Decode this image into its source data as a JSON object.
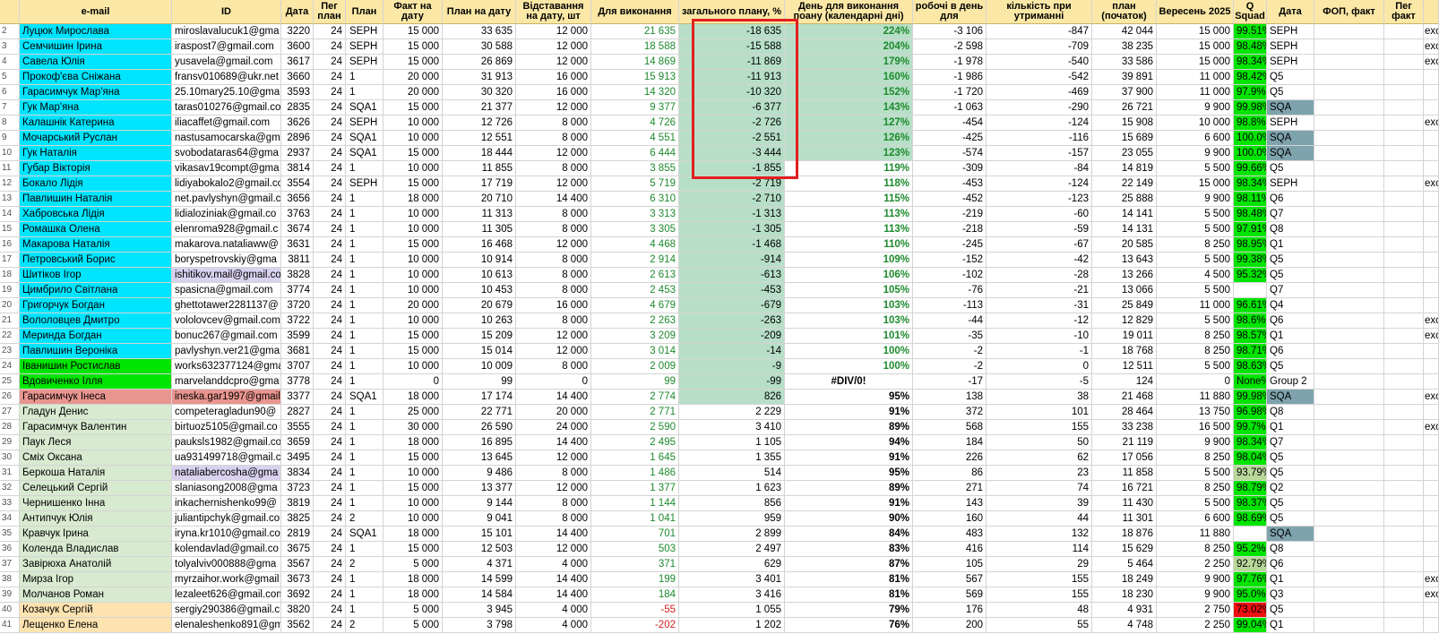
{
  "headers": [
    "",
    "e-mail",
    "ID",
    "Дата",
    "Пег план",
    "План",
    "Факт на дату",
    "План на дату",
    "Відставання на дату, шт",
    "Для виконання",
    "загального плану, %",
    "День для виконання поану (календарні дні)",
    "робочі в день для",
    "кількість при утриманні",
    "план (початок)",
    "Вересень 2025",
    "Q Squad",
    "Дата",
    "ФОП, факт",
    "Пег факт",
    ""
  ],
  "rows": [
    {
      "rn": "2",
      "name": "Луцюк Мирослава",
      "email": "miroslavalucuk1@gma",
      "id": "3220",
      "d": "24",
      "peg": "SEPH",
      "plan": "15 000",
      "fact": "33 635",
      "pd": "12 000",
      "lag": "21 635",
      "need": "-18 635",
      "pct": "224%",
      "days": "-3 106",
      "wd": "-847",
      "ret": "42 044",
      "ps": "15 000",
      "sep": "99.51%",
      "sq": "SEPH",
      "extra": "exc"
    },
    {
      "rn": "3",
      "name": "Семчишин Ірина",
      "email": "iraspost7@gmail.com",
      "id": "3600",
      "d": "24",
      "peg": "SEPH",
      "plan": "15 000",
      "fact": "30 588",
      "pd": "12 000",
      "lag": "18 588",
      "need": "-15 588",
      "pct": "204%",
      "days": "-2 598",
      "wd": "-709",
      "ret": "38 235",
      "ps": "15 000",
      "sep": "98.48%",
      "sq": "SEPH",
      "extra": "exc"
    },
    {
      "rn": "4",
      "name": "Савела Юлія",
      "email": "yusavela@gmail.com",
      "id": "3617",
      "d": "24",
      "peg": "SEPH",
      "plan": "15 000",
      "fact": "26 869",
      "pd": "12 000",
      "lag": "14 869",
      "need": "-11 869",
      "pct": "179%",
      "days": "-1 978",
      "wd": "-540",
      "ret": "33 586",
      "ps": "15 000",
      "sep": "98.34%",
      "sq": "SEPH",
      "extra": "exc"
    },
    {
      "rn": "5",
      "name": "Прокоф'єва Сніжана",
      "email": "fransv010689@ukr.net",
      "id": "3660",
      "d": "24",
      "peg": "1",
      "plan": "20 000",
      "fact": "31 913",
      "pd": "16 000",
      "lag": "15 913",
      "need": "-11 913",
      "pct": "160%",
      "days": "-1 986",
      "wd": "-542",
      "ret": "39 891",
      "ps": "11 000",
      "sep": "98.42%",
      "sq": "Q5",
      "extra": ""
    },
    {
      "rn": "6",
      "name": "Гарасимчук Мар'яна",
      "email": "25.10mary25.10@gma",
      "id": "3593",
      "d": "24",
      "peg": "1",
      "plan": "20 000",
      "fact": "30 320",
      "pd": "16 000",
      "lag": "14 320",
      "need": "-10 320",
      "pct": "152%",
      "days": "-1 720",
      "wd": "-469",
      "ret": "37 900",
      "ps": "11 000",
      "sep": "97.9%",
      "sq": "Q5",
      "extra": ""
    },
    {
      "rn": "7",
      "name": "Гук Мар'яна",
      "email": "taras010276@gmail.co",
      "id": "2835",
      "d": "24",
      "peg": "SQA1",
      "plan": "15 000",
      "fact": "21 377",
      "pd": "12 000",
      "lag": "9 377",
      "need": "-6 377",
      "pct": "143%",
      "days": "-1 063",
      "wd": "-290",
      "ret": "26 721",
      "ps": "9 900",
      "sep": "99.98%",
      "sq": "SQA",
      "extra": ""
    },
    {
      "rn": "8",
      "name": "Калашнік Катерина",
      "email": "iliacaffet@gmail.com",
      "id": "3626",
      "d": "24",
      "peg": "SEPH",
      "plan": "10 000",
      "fact": "12 726",
      "pd": "8 000",
      "lag": "4 726",
      "need": "-2 726",
      "pct": "127%",
      "days": "-454",
      "wd": "-124",
      "ret": "15 908",
      "ps": "10 000",
      "sep": "98.8%",
      "sq": "SEPH",
      "extra": "exc"
    },
    {
      "rn": "9",
      "name": "Мочарський Руслан",
      "email": "nastusamocarska@gma",
      "id": "2896",
      "d": "24",
      "peg": "SQA1",
      "plan": "10 000",
      "fact": "12 551",
      "pd": "8 000",
      "lag": "4 551",
      "need": "-2 551",
      "pct": "126%",
      "days": "-425",
      "wd": "-116",
      "ret": "15 689",
      "ps": "6 600",
      "sep": "100.0%",
      "sq": "SQA",
      "extra": ""
    },
    {
      "rn": "10",
      "name": "Гук Наталія",
      "email": "svobodataras64@gma",
      "id": "2937",
      "d": "24",
      "peg": "SQA1",
      "plan": "15 000",
      "fact": "18 444",
      "pd": "12 000",
      "lag": "6 444",
      "need": "-3 444",
      "pct": "123%",
      "days": "-574",
      "wd": "-157",
      "ret": "23 055",
      "ps": "9 900",
      "sep": "100.0%",
      "sq": "SQA",
      "extra": ""
    },
    {
      "rn": "11",
      "name": "Губар Вікторія",
      "email": "vikasav19compt@gma",
      "id": "3814",
      "d": "24",
      "peg": "1",
      "plan": "10 000",
      "fact": "11 855",
      "pd": "8 000",
      "lag": "3 855",
      "need": "-1 855",
      "pct": "119%",
      "days": "-309",
      "wd": "-84",
      "ret": "14 819",
      "ps": "5 500",
      "sep": "99.66%",
      "sq": "Q5",
      "extra": ""
    },
    {
      "rn": "12",
      "name": "Бокало Лідія",
      "email": "lidiyabokalo2@gmail.co",
      "id": "3554",
      "d": "24",
      "peg": "SEPH",
      "plan": "15 000",
      "fact": "17 719",
      "pd": "12 000",
      "lag": "5 719",
      "need": "-2 719",
      "pct": "118%",
      "days": "-453",
      "wd": "-124",
      "ret": "22 149",
      "ps": "15 000",
      "sep": "98.34%",
      "sq": "SEPH",
      "extra": "exc"
    },
    {
      "rn": "13",
      "name": "Павлишин Наталія",
      "email": "net.pavlyshyn@gmail.c",
      "id": "3656",
      "d": "24",
      "peg": "1",
      "plan": "18 000",
      "fact": "20 710",
      "pd": "14 400",
      "lag": "6 310",
      "need": "-2 710",
      "pct": "115%",
      "days": "-452",
      "wd": "-123",
      "ret": "25 888",
      "ps": "9 900",
      "sep": "98.11%",
      "sq": "Q6",
      "extra": ""
    },
    {
      "rn": "14",
      "name": "Хабровська Лідія",
      "email": "lidialoziniak@gmail.co",
      "id": "3763",
      "d": "24",
      "peg": "1",
      "plan": "10 000",
      "fact": "11 313",
      "pd": "8 000",
      "lag": "3 313",
      "need": "-1 313",
      "pct": "113%",
      "days": "-219",
      "wd": "-60",
      "ret": "14 141",
      "ps": "5 500",
      "sep": "98.48%",
      "sq": "Q7",
      "extra": ""
    },
    {
      "rn": "15",
      "name": "Ромашка Олена",
      "email": "elenroma928@gmail.c",
      "id": "3674",
      "d": "24",
      "peg": "1",
      "plan": "10 000",
      "fact": "11 305",
      "pd": "8 000",
      "lag": "3 305",
      "need": "-1 305",
      "pct": "113%",
      "days": "-218",
      "wd": "-59",
      "ret": "14 131",
      "ps": "5 500",
      "sep": "97.91%",
      "sq": "Q8",
      "extra": ""
    },
    {
      "rn": "16",
      "name": "Макарова Наталія",
      "email": "makarova.nataliaww@",
      "id": "3631",
      "d": "24",
      "peg": "1",
      "plan": "15 000",
      "fact": "16 468",
      "pd": "12 000",
      "lag": "4 468",
      "need": "-1 468",
      "pct": "110%",
      "days": "-245",
      "wd": "-67",
      "ret": "20 585",
      "ps": "8 250",
      "sep": "98.95%",
      "sq": "Q1",
      "extra": ""
    },
    {
      "rn": "17",
      "name": "Петровський Борис",
      "email": "boryspetrovskiy@gma",
      "id": "3811",
      "d": "24",
      "peg": "1",
      "plan": "10 000",
      "fact": "10 914",
      "pd": "8 000",
      "lag": "2 914",
      "need": "-914",
      "pct": "109%",
      "days": "-152",
      "wd": "-42",
      "ret": "13 643",
      "ps": "5 500",
      "sep": "99.38%",
      "sq": "Q5",
      "extra": ""
    },
    {
      "rn": "18",
      "name": "Шитіков Ігор",
      "email": "ishitikov.mail@gmail.co",
      "id": "3828",
      "d": "24",
      "peg": "1",
      "plan": "10 000",
      "fact": "10 613",
      "pd": "8 000",
      "lag": "2 613",
      "need": "-613",
      "pct": "106%",
      "days": "-102",
      "wd": "-28",
      "ret": "13 266",
      "ps": "4 500",
      "sep": "95.32%",
      "sq": "Q5",
      "extra": ""
    },
    {
      "rn": "19",
      "name": "Цимбрило Світлана",
      "email": "spasicna@gmail.com",
      "id": "3774",
      "d": "24",
      "peg": "1",
      "plan": "10 000",
      "fact": "10 453",
      "pd": "8 000",
      "lag": "2 453",
      "need": "-453",
      "pct": "105%",
      "days": "-76",
      "wd": "-21",
      "ret": "13 066",
      "ps": "5 500",
      "sep": "",
      "sq": "Q7",
      "extra": ""
    },
    {
      "rn": "20",
      "name": "Григорчук Богдан",
      "email": "ghettotawer2281137@",
      "id": "3720",
      "d": "24",
      "peg": "1",
      "plan": "20 000",
      "fact": "20 679",
      "pd": "16 000",
      "lag": "4 679",
      "need": "-679",
      "pct": "103%",
      "days": "-113",
      "wd": "-31",
      "ret": "25 849",
      "ps": "11 000",
      "sep": "96.61%",
      "sq": "Q4",
      "extra": ""
    },
    {
      "rn": "21",
      "name": "Вололовцев Дмитро",
      "email": "vololovcev@gmail.com",
      "id": "3722",
      "d": "24",
      "peg": "1",
      "plan": "10 000",
      "fact": "10 263",
      "pd": "8 000",
      "lag": "2 263",
      "need": "-263",
      "pct": "103%",
      "days": "-44",
      "wd": "-12",
      "ret": "12 829",
      "ps": "5 500",
      "sep": "98.6%",
      "sq": "Q6",
      "extra": "exc"
    },
    {
      "rn": "22",
      "name": "Меринда Богдан",
      "email": "bonuc267@gmail.com",
      "id": "3599",
      "d": "24",
      "peg": "1",
      "plan": "15 000",
      "fact": "15 209",
      "pd": "12 000",
      "lag": "3 209",
      "need": "-209",
      "pct": "101%",
      "days": "-35",
      "wd": "-10",
      "ret": "19 011",
      "ps": "8 250",
      "sep": "98.57%",
      "sq": "Q1",
      "extra": "exc"
    },
    {
      "rn": "23",
      "name": "Павлишин Вероніка",
      "email": "pavlyshyn.ver21@gma",
      "id": "3681",
      "d": "24",
      "peg": "1",
      "plan": "15 000",
      "fact": "15 014",
      "pd": "12 000",
      "lag": "3 014",
      "need": "-14",
      "pct": "100%",
      "days": "-2",
      "wd": "-1",
      "ret": "18 768",
      "ps": "8 250",
      "sep": "98.71%",
      "sq": "Q6",
      "extra": ""
    },
    {
      "rn": "24",
      "name": "Іванишин Ростислав",
      "email": "works632377124@gma",
      "id": "3707",
      "d": "24",
      "peg": "1",
      "plan": "10 000",
      "fact": "10 009",
      "pd": "8 000",
      "lag": "2 009",
      "need": "-9",
      "pct": "100%",
      "days": "-2",
      "wd": "0",
      "ret": "12 511",
      "ps": "5 500",
      "sep": "98.63%",
      "sq": "Q5",
      "extra": ""
    },
    {
      "rn": "25",
      "name": "Вдовиченко Ілля",
      "email": "marvelanddcpro@gma",
      "id": "3778",
      "d": "24",
      "peg": "1",
      "plan": "0",
      "fact": "99",
      "pd": "0",
      "lag": "99",
      "need": "-99",
      "pct": "#DIV/0!",
      "days": "-17",
      "wd": "-5",
      "ret": "124",
      "ps": "0",
      "sep": "None%",
      "sq": "Group 2",
      "extra": ""
    },
    {
      "rn": "26",
      "name": "Гарасимчук Інеса",
      "email": "ineska.gar1997@gmail",
      "id": "3377",
      "d": "24",
      "peg": "SQA1",
      "plan": "18 000",
      "fact": "17 174",
      "pd": "14 400",
      "lag": "2 774",
      "need": "826",
      "pct": "95%",
      "days": "138",
      "wd": "38",
      "ret": "21 468",
      "ps": "11 880",
      "sep": "99.98%",
      "sq": "SQA",
      "extra": "exc"
    },
    {
      "rn": "27",
      "name": "Гладун Денис",
      "email": "competeragladun90@",
      "id": "2827",
      "d": "24",
      "peg": "1",
      "plan": "25 000",
      "fact": "22 771",
      "pd": "20 000",
      "lag": "2 771",
      "need": "2 229",
      "pct": "91%",
      "days": "372",
      "wd": "101",
      "ret": "28 464",
      "ps": "13 750",
      "sep": "96.98%",
      "sq": "Q8",
      "extra": ""
    },
    {
      "rn": "28",
      "name": "Гарасимчук Валентин",
      "email": "birtuoz5105@gmail.co",
      "id": "3555",
      "d": "24",
      "peg": "1",
      "plan": "30 000",
      "fact": "26 590",
      "pd": "24 000",
      "lag": "2 590",
      "need": "3 410",
      "pct": "89%",
      "days": "568",
      "wd": "155",
      "ret": "33 238",
      "ps": "16 500",
      "sep": "99.7%",
      "sq": "Q1",
      "extra": "exc"
    },
    {
      "rn": "29",
      "name": "Паук Леся",
      "email": "pauksls1982@gmail.co",
      "id": "3659",
      "d": "24",
      "peg": "1",
      "plan": "18 000",
      "fact": "16 895",
      "pd": "14 400",
      "lag": "2 495",
      "need": "1 105",
      "pct": "94%",
      "days": "184",
      "wd": "50",
      "ret": "21 119",
      "ps": "9 900",
      "sep": "98.34%",
      "sq": "Q7",
      "extra": ""
    },
    {
      "rn": "30",
      "name": "Сміх Оксана",
      "email": "ua931499718@gmail.c",
      "id": "3495",
      "d": "24",
      "peg": "1",
      "plan": "15 000",
      "fact": "13 645",
      "pd": "12 000",
      "lag": "1 645",
      "need": "1 355",
      "pct": "91%",
      "days": "226",
      "wd": "62",
      "ret": "17 056",
      "ps": "8 250",
      "sep": "98.04%",
      "sq": "Q5",
      "extra": ""
    },
    {
      "rn": "31",
      "name": "Беркоша Наталія",
      "email": "nataliabercosha@gma",
      "id": "3834",
      "d": "24",
      "peg": "1",
      "plan": "10 000",
      "fact": "9 486",
      "pd": "8 000",
      "lag": "1 486",
      "need": "514",
      "pct": "95%",
      "days": "86",
      "wd": "23",
      "ret": "11 858",
      "ps": "5 500",
      "sep": "93.79%",
      "sq": "Q5",
      "extra": ""
    },
    {
      "rn": "32",
      "name": "Селецький Сергій",
      "email": "slaniasong2008@gma",
      "id": "3723",
      "d": "24",
      "peg": "1",
      "plan": "15 000",
      "fact": "13 377",
      "pd": "12 000",
      "lag": "1 377",
      "need": "1 623",
      "pct": "89%",
      "days": "271",
      "wd": "74",
      "ret": "16 721",
      "ps": "8 250",
      "sep": "98.79%",
      "sq": "Q2",
      "extra": ""
    },
    {
      "rn": "33",
      "name": "Чернишенко Інна",
      "email": "inkachernishenko99@",
      "id": "3819",
      "d": "24",
      "peg": "1",
      "plan": "10 000",
      "fact": "9 144",
      "pd": "8 000",
      "lag": "1 144",
      "need": "856",
      "pct": "91%",
      "days": "143",
      "wd": "39",
      "ret": "11 430",
      "ps": "5 500",
      "sep": "98.37%",
      "sq": "Q5",
      "extra": ""
    },
    {
      "rn": "34",
      "name": "Антипчук Юлія",
      "email": "juliantipchyk@gmail.co",
      "id": "3825",
      "d": "24",
      "peg": "2",
      "plan": "10 000",
      "fact": "9 041",
      "pd": "8 000",
      "lag": "1 041",
      "need": "959",
      "pct": "90%",
      "days": "160",
      "wd": "44",
      "ret": "11 301",
      "ps": "6 600",
      "sep": "98.69%",
      "sq": "Q5",
      "extra": ""
    },
    {
      "rn": "35",
      "name": "Кравчук Ірина",
      "email": "iryna.kr1010@gmail.co",
      "id": "2819",
      "d": "24",
      "peg": "SQA1",
      "plan": "18 000",
      "fact": "15 101",
      "pd": "14 400",
      "lag": "701",
      "need": "2 899",
      "pct": "84%",
      "days": "483",
      "wd": "132",
      "ret": "18 876",
      "ps": "11 880",
      "sep": "",
      "sq": "SQA",
      "extra": ""
    },
    {
      "rn": "36",
      "name": "Колендa Владислав",
      "email": "kolendavlad@gmail.co",
      "id": "3675",
      "d": "24",
      "peg": "1",
      "plan": "15 000",
      "fact": "12 503",
      "pd": "12 000",
      "lag": "503",
      "need": "2 497",
      "pct": "83%",
      "days": "416",
      "wd": "114",
      "ret": "15 629",
      "ps": "8 250",
      "sep": "95.2%",
      "sq": "Q8",
      "extra": ""
    },
    {
      "rn": "37",
      "name": "Завірюха Анатолій",
      "email": "tolyalviv000888@gma",
      "id": "3567",
      "d": "24",
      "peg": "2",
      "plan": "5 000",
      "fact": "4 371",
      "pd": "4 000",
      "lag": "371",
      "need": "629",
      "pct": "87%",
      "days": "105",
      "wd": "29",
      "ret": "5 464",
      "ps": "2 250",
      "sep": "92.79%",
      "sq": "Q6",
      "extra": ""
    },
    {
      "rn": "38",
      "name": "Мирза Ігор",
      "email": "myrzaihor.work@gmail",
      "id": "3673",
      "d": "24",
      "peg": "1",
      "plan": "18 000",
      "fact": "14 599",
      "pd": "14 400",
      "lag": "199",
      "need": "3 401",
      "pct": "81%",
      "days": "567",
      "wd": "155",
      "ret": "18 249",
      "ps": "9 900",
      "sep": "97.76%",
      "sq": "Q1",
      "extra": "exc"
    },
    {
      "rn": "39",
      "name": "Молчанов Роман",
      "email": "lezaleet626@gmail.com",
      "id": "3692",
      "d": "24",
      "peg": "1",
      "plan": "18 000",
      "fact": "14 584",
      "pd": "14 400",
      "lag": "184",
      "need": "3 416",
      "pct": "81%",
      "days": "569",
      "wd": "155",
      "ret": "18 230",
      "ps": "9 900",
      "sep": "95.0%",
      "sq": "Q3",
      "extra": "exc"
    },
    {
      "rn": "40",
      "name": "Козачук Сергій",
      "email": "sergiy290386@gmail.c",
      "id": "3820",
      "d": "24",
      "peg": "1",
      "plan": "5 000",
      "fact": "3 945",
      "pd": "4 000",
      "lag": "-55",
      "need": "1 055",
      "pct": "79%",
      "days": "176",
      "wd": "48",
      "ret": "4 931",
      "ps": "2 750",
      "sep": "73.02%",
      "sq": "Q5",
      "extra": ""
    },
    {
      "rn": "41",
      "name": "Лещенко Елена",
      "email": "elenaleshenko891@gm",
      "id": "3562",
      "d": "24",
      "peg": "2",
      "plan": "5 000",
      "fact": "3 798",
      "pd": "4 000",
      "lag": "-202",
      "need": "1 202",
      "pct": "76%",
      "days": "200",
      "wd": "55",
      "ret": "4 748",
      "ps": "2 250",
      "sep": "99.04%",
      "sq": "Q1",
      "extra": ""
    }
  ],
  "colors": {
    "header_bg": "#fbe8a6",
    "cyan": "#00e5ff",
    "bright_green": "#00e500",
    "salmon": "#e9958f",
    "pale_green": "#d8ead0",
    "peach": "#fde3b0",
    "lavender": "#d9d2ef",
    "mint": "#b7dfc7",
    "sqa_blue": "#7fa3ad",
    "red": "#ee1111",
    "light_olive": "#b8d89a"
  }
}
